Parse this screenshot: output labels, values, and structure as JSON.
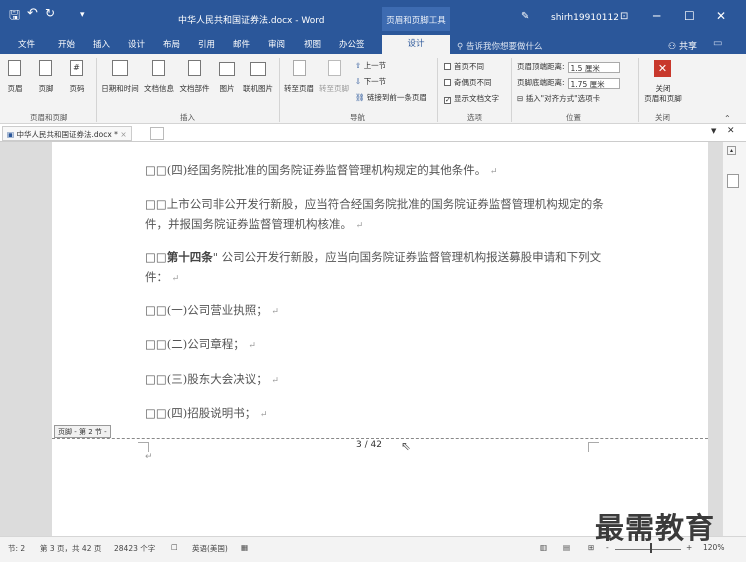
{
  "window": {
    "title": "中华人民共和国证券法.docx - Word",
    "context_tab_group": "页眉和页脚工具",
    "user": "shirh19910112"
  },
  "qat": {
    "save": "🖫",
    "undo": "↶",
    "redo": "↻",
    "customize": "▾"
  },
  "tabs": [
    "文件",
    "开始",
    "插入",
    "设计",
    "布局",
    "引用",
    "邮件",
    "审阅",
    "视图",
    "办公签"
  ],
  "active_tab": "设计",
  "tell_me": "告诉我你想要做什么",
  "share": "共享",
  "ribbon": {
    "hf_group": {
      "label": "页眉和页脚",
      "header": "页眉",
      "footer": "页脚",
      "page_number": "页码"
    },
    "insert_group": {
      "label": "插入",
      "datetime": "日期和时间",
      "docinfo": "文档信息",
      "docparts": "文档部件",
      "picture": "图片",
      "online_picture": "联机图片"
    },
    "nav_group": {
      "label": "导航",
      "goto_header": "转至页眉",
      "goto_footer": "转至页脚",
      "previous": "上一节",
      "next": "下一节",
      "link_previous": "链接到前一条页眉"
    },
    "options_group": {
      "label": "选项",
      "diff_first": "首页不同",
      "diff_odd_even": "奇偶页不同",
      "show_doc_text": "显示文档文字"
    },
    "position_group": {
      "label": "位置",
      "header_from_top": "页眉顶端距离:",
      "header_from_top_value": "1.5 厘米",
      "footer_from_bottom": "页脚底端距离:",
      "footer_from_bottom_value": "1.75 厘米",
      "insert_align_tab": "插入\"对齐方式\"选项卡"
    },
    "close_group": {
      "label": "关闭",
      "close_line1": "关闭",
      "close_line2": "页眉和页脚"
    }
  },
  "doc_tab": {
    "name": "中华人民共和国证券法.docx *",
    "close": "×"
  },
  "document": {
    "paragraphs": [
      {
        "text": "□□(四)经国务院批准的国务院证券监督管理机构规定的其他条件。",
        "mark": "↵"
      },
      {
        "text": "□□上市公司非公开发行新股，应当符合经国务院批准的国务院证券监督管理机构规定的条件，并报国务院证券监督管理机构核准。",
        "mark": "↵"
      },
      {
        "prefix": "□□",
        "bold": "第十四条",
        "text": "\" 公司公开发行新股，应当向国务院证券监督管理机构报送募股申请和下列文件：",
        "mark": "↵"
      },
      {
        "text": "□□(一)公司营业执照；",
        "mark": "↵"
      },
      {
        "text": "□□(二)公司章程；",
        "mark": "↵"
      },
      {
        "text": "□□(三)股东大会决议；",
        "mark": "↵"
      },
      {
        "text": "□□(四)招股说明书；",
        "mark": "↵"
      }
    ],
    "footer_tag": "页脚 - 第 2 节 -",
    "page_number": "3 / 42",
    "footer_para_mark": "↵"
  },
  "status": {
    "section": "节: 2",
    "page": "第 3 页，共 42 页",
    "words": "28423 个字",
    "language": "英语(美国)",
    "zoom": "120%",
    "zoom_minus": "-",
    "zoom_plus": "+"
  },
  "watermark": "最需教育",
  "colors": {
    "brand": "#2b579a",
    "close_button": "#c8382c",
    "page": "#ffffff",
    "doc_background": "#dcdcdc"
  }
}
